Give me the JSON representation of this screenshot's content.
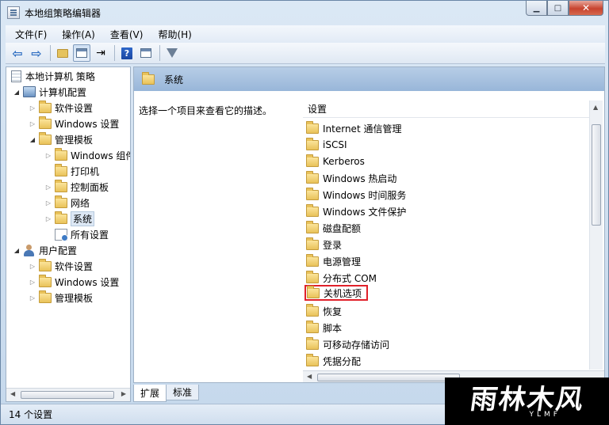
{
  "window": {
    "title": "本地组策略编辑器",
    "min_glyph": "▁",
    "max_glyph": "□",
    "close_glyph": "✕"
  },
  "menu": [
    "文件(F)",
    "操作(A)",
    "查看(V)",
    "帮助(H)"
  ],
  "toolbar": {
    "back_glyph": "⇦",
    "forward_glyph": "⇨",
    "help_glyph": "?",
    "export_glyph": "⇥"
  },
  "tree": {
    "root": "本地计算机 策略",
    "computer_config": "计算机配置",
    "computer_children": [
      "软件设置",
      "Windows 设置",
      "管理模板"
    ],
    "admin_templates_children": [
      "Windows 组件",
      "打印机",
      "控制面板",
      "网络",
      "系统",
      "所有设置"
    ],
    "user_config": "用户配置",
    "user_children": [
      "软件设置",
      "Windows 设置",
      "管理模板"
    ],
    "collapsed_glyph": "▷",
    "expanded_glyph": "◢"
  },
  "content": {
    "header_title": "系统",
    "description": "选择一个项目来查看它的描述。",
    "column_header": "设置",
    "items": [
      "Internet 通信管理",
      "iSCSI",
      "Kerberos",
      "Windows 热启动",
      "Windows 时间服务",
      "Windows 文件保护",
      "磁盘配额",
      "登录",
      "电源管理",
      "分布式 COM",
      "关机选项",
      "恢复",
      "脚本",
      "可移动存储访问",
      "凭据分配"
    ],
    "highlighted_item": "关机选项"
  },
  "tabs": [
    "扩展",
    "标准"
  ],
  "status": "14 个设置",
  "watermark": {
    "main": "雨林木风",
    "sub": "YLMF"
  },
  "colors": {
    "highlight_border": "#e0212a",
    "header_band": "#98b6d9",
    "folder": "#e9c25a"
  }
}
